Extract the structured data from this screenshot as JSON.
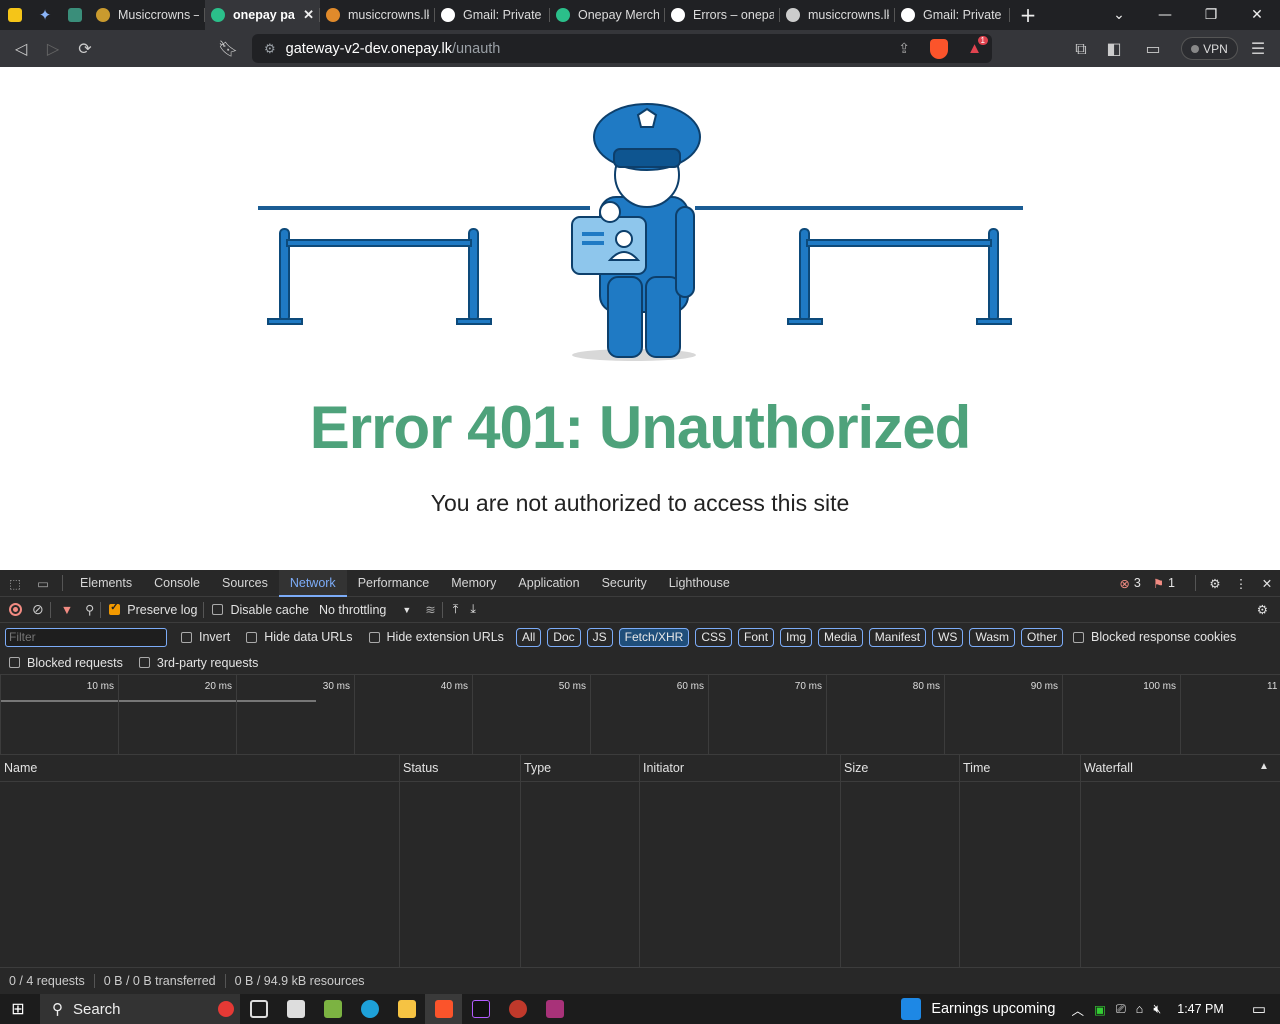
{
  "browser": {
    "tabs": [
      {
        "label": "Musiccrowns –",
        "color": "#c99a2e"
      },
      {
        "label": "onepay pa",
        "color": "#2bbf8a",
        "active": true
      },
      {
        "label": "musiccrowns.lk",
        "color": "#e08a2b"
      },
      {
        "label": "Gmail: Private",
        "color": "#ffffff"
      },
      {
        "label": "Onepay Merch",
        "color": "#2bbf8a"
      },
      {
        "label": "Errors – onepa",
        "color": "#ffffff"
      },
      {
        "label": "musiccrowns.lk",
        "color": "#cccccc"
      },
      {
        "label": "Gmail: Private",
        "color": "#ffffff"
      }
    ],
    "url_host": "gateway-v2-dev.onepay.lk",
    "url_path": "/unauth",
    "vpn_label": "VPN",
    "brave_badge": "1"
  },
  "page": {
    "error_title": "Error 401: Unauthorized",
    "error_subtitle": "You are not authorized to access this site"
  },
  "devtools": {
    "tabs": [
      "Elements",
      "Console",
      "Sources",
      "Network",
      "Performance",
      "Memory",
      "Application",
      "Security",
      "Lighthouse"
    ],
    "active_tab": "Network",
    "error_count": "3",
    "issue_count": "1",
    "preserve_log": "Preserve log",
    "disable_cache": "Disable cache",
    "throttling": "No throttling",
    "filter_placeholder": "Filter",
    "invert": "Invert",
    "hide_data_urls": "Hide data URLs",
    "hide_ext_urls": "Hide extension URLs",
    "type_filters": [
      "All",
      "Doc",
      "JS",
      "Fetch/XHR",
      "CSS",
      "Font",
      "Img",
      "Media",
      "Manifest",
      "WS",
      "Wasm",
      "Other"
    ],
    "active_filter": "Fetch/XHR",
    "blocked_cookies": "Blocked response cookies",
    "blocked_requests": "Blocked requests",
    "third_party": "3rd-party requests",
    "timeline_ticks": [
      "10 ms",
      "20 ms",
      "30 ms",
      "40 ms",
      "50 ms",
      "60 ms",
      "70 ms",
      "80 ms",
      "90 ms",
      "100 ms",
      "11"
    ],
    "columns": [
      "Name",
      "Status",
      "Type",
      "Initiator",
      "Size",
      "Time",
      "Waterfall"
    ],
    "status_requests": "0 / 4 requests",
    "status_transferred": "0 B / 0 B transferred",
    "status_resources": "0 B / 94.9 kB resources"
  },
  "taskbar": {
    "search": "Search",
    "news": "Earnings upcoming",
    "time": "1:47 PM"
  }
}
